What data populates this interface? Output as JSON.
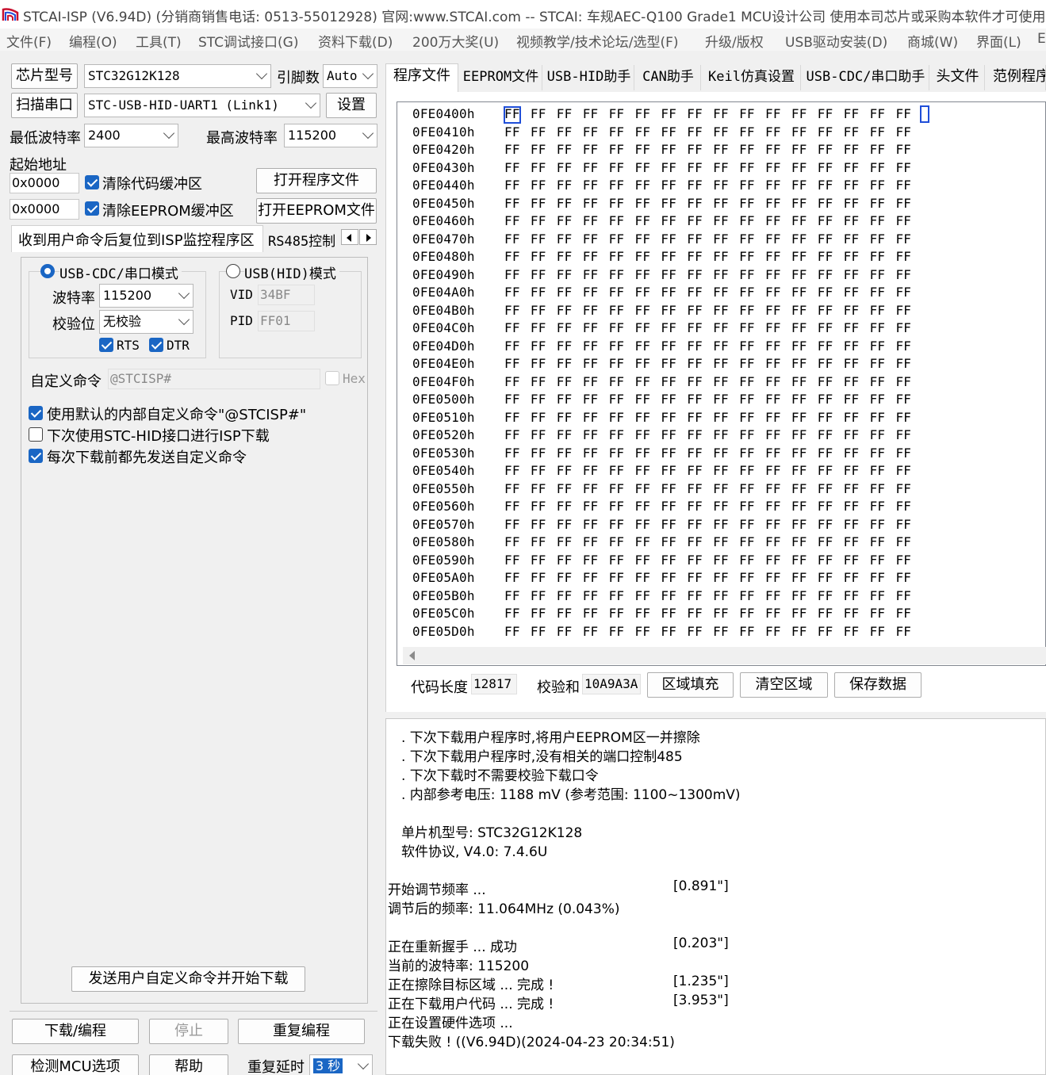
{
  "window": {
    "title": "STCAI-ISP (V6.94D) (分销商销售电话: 0513-55012928) 官网:www.STCAI.com  -- STCAI: 车规AEC-Q100 Grade1 MCU设计公司 使用本司芯片或采购本软件才可使用本"
  },
  "menu": [
    "文件(F)",
    "编程(O)",
    "工具(T)",
    "STC调试接口(G)",
    "资料下载(D)",
    "200万大奖(U)",
    "视频教学/技术论坛/选型(F)",
    "升级/版权",
    "USB驱动安装(D)",
    "商城(W)",
    "界面(L)",
    "E"
  ],
  "left": {
    "chip_model_btn": "芯片型号",
    "chip_model_value": "STC32G12K128",
    "pin_count_label": "引脚数",
    "pin_count_value": "Auto",
    "scan_port_btn": "扫描串口",
    "port_value": "STC-USB-HID-UART1 (Link1)",
    "settings_btn": "设置",
    "min_baud_label": "最低波特率",
    "min_baud_value": "2400",
    "max_baud_label": "最高波特率",
    "max_baud_value": "115200",
    "start_addr_label": "起始地址",
    "code_addr": "0x0000",
    "eeprom_addr": "0x0000",
    "clear_code_label": "清除代码缓冲区",
    "clear_eeprom_label": "清除EEPROM缓冲区",
    "open_program_btn": "打开程序文件",
    "open_eeprom_btn": "打开EEPROM文件",
    "subtab_active": "收到用户命令后复位到ISP监控程序区",
    "subtab_other": "RS485控制",
    "mode_cdc_label": "USB-CDC/串口模式",
    "mode_hid_label": "USB(HID)模式",
    "baud_label": "波特率",
    "baud_value": "115200",
    "parity_label": "校验位",
    "parity_value": "无校验",
    "rts_label": "RTS",
    "dtr_label": "DTR",
    "vid_label": "VID",
    "vid_value": "34BF",
    "pid_label": "PID",
    "pid_value": "FF01",
    "custom_cmd_label": "自定义命令",
    "custom_cmd_value": "@STCISP#",
    "hex_label": "Hex",
    "opt_default_cmd": "使用默认的内部自定义命令\"@STCISP#\"",
    "opt_next_hid": "下次使用STC-HID接口进行ISP下载",
    "opt_send_before": "每次下载前都先发送自定义命令",
    "send_cmd_btn": "发送用户自定义命令并开始下载",
    "download_btn": "下载/编程",
    "stop_btn": "停止",
    "reprogram_btn": "重复编程",
    "detect_btn": "检测MCU选项",
    "help_btn": "帮助",
    "repeat_delay_label": "重复延时",
    "repeat_delay_value": "3 秒"
  },
  "tabs": [
    "程序文件",
    "EEPROM文件",
    "USB-HID助手",
    "CAN助手",
    "Keil仿真设置",
    "USB-CDC/串口助手",
    "头文件",
    "范例程序"
  ],
  "hex": {
    "rows": [
      {
        "addr": "0FE0400h",
        "bytes": "FF FF FF FF FF FF FF FF FF FF FF FF FF FF FF FF"
      },
      {
        "addr": "0FE0410h",
        "bytes": "FF FF FF FF FF FF FF FF FF FF FF FF FF FF FF FF"
      },
      {
        "addr": "0FE0420h",
        "bytes": "FF FF FF FF FF FF FF FF FF FF FF FF FF FF FF FF"
      },
      {
        "addr": "0FE0430h",
        "bytes": "FF FF FF FF FF FF FF FF FF FF FF FF FF FF FF FF"
      },
      {
        "addr": "0FE0440h",
        "bytes": "FF FF FF FF FF FF FF FF FF FF FF FF FF FF FF FF"
      },
      {
        "addr": "0FE0450h",
        "bytes": "FF FF FF FF FF FF FF FF FF FF FF FF FF FF FF FF"
      },
      {
        "addr": "0FE0460h",
        "bytes": "FF FF FF FF FF FF FF FF FF FF FF FF FF FF FF FF"
      },
      {
        "addr": "0FE0470h",
        "bytes": "FF FF FF FF FF FF FF FF FF FF FF FF FF FF FF FF"
      },
      {
        "addr": "0FE0480h",
        "bytes": "FF FF FF FF FF FF FF FF FF FF FF FF FF FF FF FF"
      },
      {
        "addr": "0FE0490h",
        "bytes": "FF FF FF FF FF FF FF FF FF FF FF FF FF FF FF FF"
      },
      {
        "addr": "0FE04A0h",
        "bytes": "FF FF FF FF FF FF FF FF FF FF FF FF FF FF FF FF"
      },
      {
        "addr": "0FE04B0h",
        "bytes": "FF FF FF FF FF FF FF FF FF FF FF FF FF FF FF FF"
      },
      {
        "addr": "0FE04C0h",
        "bytes": "FF FF FF FF FF FF FF FF FF FF FF FF FF FF FF FF"
      },
      {
        "addr": "0FE04D0h",
        "bytes": "FF FF FF FF FF FF FF FF FF FF FF FF FF FF FF FF"
      },
      {
        "addr": "0FE04E0h",
        "bytes": "FF FF FF FF FF FF FF FF FF FF FF FF FF FF FF FF"
      },
      {
        "addr": "0FE04F0h",
        "bytes": "FF FF FF FF FF FF FF FF FF FF FF FF FF FF FF FF"
      },
      {
        "addr": "0FE0500h",
        "bytes": "FF FF FF FF FF FF FF FF FF FF FF FF FF FF FF FF"
      },
      {
        "addr": "0FE0510h",
        "bytes": "FF FF FF FF FF FF FF FF FF FF FF FF FF FF FF FF"
      },
      {
        "addr": "0FE0520h",
        "bytes": "FF FF FF FF FF FF FF FF FF FF FF FF FF FF FF FF"
      },
      {
        "addr": "0FE0530h",
        "bytes": "FF FF FF FF FF FF FF FF FF FF FF FF FF FF FF FF"
      },
      {
        "addr": "0FE0540h",
        "bytes": "FF FF FF FF FF FF FF FF FF FF FF FF FF FF FF FF"
      },
      {
        "addr": "0FE0550h",
        "bytes": "FF FF FF FF FF FF FF FF FF FF FF FF FF FF FF FF"
      },
      {
        "addr": "0FE0560h",
        "bytes": "FF FF FF FF FF FF FF FF FF FF FF FF FF FF FF FF"
      },
      {
        "addr": "0FE0570h",
        "bytes": "FF FF FF FF FF FF FF FF FF FF FF FF FF FF FF FF"
      },
      {
        "addr": "0FE0580h",
        "bytes": "FF FF FF FF FF FF FF FF FF FF FF FF FF FF FF FF"
      },
      {
        "addr": "0FE0590h",
        "bytes": "FF FF FF FF FF FF FF FF FF FF FF FF FF FF FF FF"
      },
      {
        "addr": "0FE05A0h",
        "bytes": "FF FF FF FF FF FF FF FF FF FF FF FF FF FF FF FF"
      },
      {
        "addr": "0FE05B0h",
        "bytes": "FF FF FF FF FF FF FF FF FF FF FF FF FF FF FF FF"
      },
      {
        "addr": "0FE05C0h",
        "bytes": "FF FF FF FF FF FF FF FF FF FF FF FF FF FF FF FF"
      },
      {
        "addr": "0FE05D0h",
        "bytes": "FF FF FF FF FF FF FF FF FF FF FF FF FF FF FF FF"
      }
    ],
    "code_length_label": "代码长度",
    "code_length_value": "12817",
    "checksum_label": "校验和",
    "checksum_value": "10A9A3A",
    "fill_btn": "区域填充",
    "clear_btn": "清空区域",
    "save_btn": "保存数据"
  },
  "log": {
    "lines": [
      {
        "text": ". 下次下载用户程序时,将用户EEPROM区一并擦除",
        "indent": 1,
        "time": ""
      },
      {
        "text": ". 下次下载用户程序时,没有相关的端口控制485",
        "indent": 1,
        "time": ""
      },
      {
        "text": ". 下次下载时不需要校验下载口令",
        "indent": 1,
        "time": ""
      },
      {
        "text": ". 内部参考电压: 1188 mV (参考范围: 1100~1300mV)",
        "indent": 1,
        "time": ""
      },
      {
        "text": "",
        "indent": 0,
        "time": ""
      },
      {
        "text": "单片机型号: STC32G12K128",
        "indent": 2,
        "time": ""
      },
      {
        "text": "软件协议, V4.0: 7.4.6U",
        "indent": 2,
        "time": ""
      },
      {
        "text": "",
        "indent": 0,
        "time": ""
      },
      {
        "text": "开始调节频率 ...",
        "indent": 0,
        "time": "[0.891\"]"
      },
      {
        "text": "调节后的频率: 11.064MHz (0.043%)",
        "indent": 0,
        "time": ""
      },
      {
        "text": "",
        "indent": 0,
        "time": ""
      },
      {
        "text": "正在重新握手 ... 成功",
        "indent": 0,
        "time": "[0.203\"]"
      },
      {
        "text": "当前的波特率: 115200",
        "indent": 0,
        "time": ""
      },
      {
        "text": "正在擦除目标区域 ... 完成 !",
        "indent": 0,
        "time": "[1.235\"]"
      },
      {
        "text": "正在下载用户代码 ... 完成 !",
        "indent": 0,
        "time": "[3.953\"]"
      },
      {
        "text": "正在设置硬件选项 ...",
        "indent": 0,
        "time": ""
      },
      {
        "text": "下载失败 ! ((V6.94D)(2024-04-23 20:34:51)",
        "indent": 0,
        "time": ""
      }
    ]
  },
  "colors": {
    "accent": "#1a66c4",
    "cursor": "#1f4ed8"
  }
}
